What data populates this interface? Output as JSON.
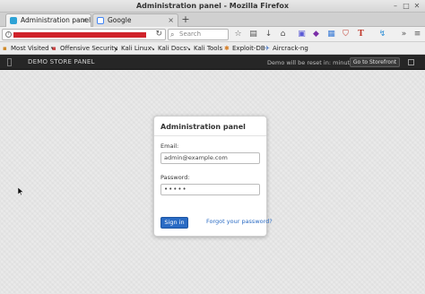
{
  "window": {
    "title": "Administration panel - Mozilla Firefox"
  },
  "tabs": [
    {
      "label": "Administration panel",
      "active": true
    },
    {
      "label": "Google",
      "active": false
    }
  ],
  "navbar": {
    "search_placeholder": "Search"
  },
  "bookmarks": [
    {
      "label": "Most Visited",
      "icon": "gear-icon"
    },
    {
      "label": "Offensive Security",
      "icon": "folder-icon"
    },
    {
      "label": "Kali Linux",
      "icon": "dragon-icon"
    },
    {
      "label": "Kali Docs",
      "icon": "dragon-icon"
    },
    {
      "label": "Kali Tools",
      "icon": "dragon-icon"
    },
    {
      "label": "Exploit-DB",
      "icon": "bug-icon"
    },
    {
      "label": "Aircrack-ng",
      "icon": "aircrack-icon"
    }
  ],
  "storebar": {
    "brand": "DEMO STORE PANEL",
    "notice": "Demo will be reset in: minute(s)",
    "storefront_button": "Go to Storefront"
  },
  "login": {
    "title": "Administration panel",
    "email_label": "Email:",
    "email_value": "admin@example.com",
    "password_label": "Password:",
    "password_value": "•••••",
    "signin_label": "Sign in",
    "forgot_label": "Forgot your password?"
  },
  "colors": {
    "accent": "#2a6bc4",
    "redacted": "#d0232b",
    "storebar": "#262626"
  }
}
